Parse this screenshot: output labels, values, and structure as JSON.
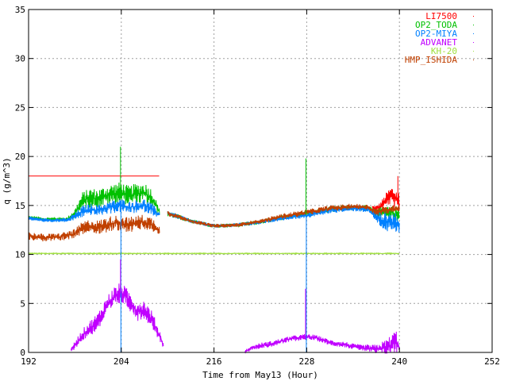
{
  "chart_data": {
    "type": "line",
    "title": "",
    "xlabel": "Time from May13 (Hour)",
    "ylabel": "q (g/m^3)",
    "xlim": [
      192,
      252
    ],
    "ylim": [
      0,
      35
    ],
    "x_ticks": [
      192,
      204,
      216,
      228,
      240,
      252
    ],
    "y_ticks": [
      0,
      5,
      10,
      15,
      20,
      25,
      30,
      35
    ],
    "x_tick_labels": [
      "192",
      "204",
      "216",
      "228",
      "240",
      "252"
    ],
    "y_tick_labels": [
      "0",
      "5",
      "10",
      "15",
      "20",
      "25",
      "30",
      "35"
    ],
    "grid": true,
    "legend_position": "top-right",
    "series": [
      {
        "name": "LI7500",
        "color": "#ff0000",
        "x": [
          192,
          209,
          209.01,
          236.5,
          237,
          237.5,
          238,
          238.5,
          239,
          239.5,
          240
        ],
        "y": [
          18,
          18,
          null,
          14.8,
          14.7,
          14.9,
          15.3,
          15.8,
          16.0,
          15.6,
          15.2
        ],
        "noise": [
          0,
          0,
          0,
          0.2,
          0.3,
          0.4,
          0.6,
          0.8,
          1.0,
          1.2,
          1.2
        ]
      },
      {
        "name": "OP2_TODA",
        "color": "#00c000",
        "x": [
          192,
          194,
          197,
          198,
          199,
          200,
          201,
          202,
          203,
          204,
          205,
          206,
          207,
          208,
          209,
          209.01,
          210,
          213,
          216,
          219,
          222,
          225,
          228,
          231,
          234,
          236,
          237,
          238,
          239,
          240
        ],
        "y": [
          13.8,
          13.6,
          13.6,
          14.2,
          15.5,
          15.8,
          15.7,
          16.0,
          16.2,
          16.3,
          16.0,
          16.2,
          16.3,
          15.7,
          14.2,
          null,
          14.2,
          13.4,
          12.9,
          13.0,
          13.3,
          13.8,
          14.2,
          14.6,
          14.8,
          14.7,
          14.2,
          14.4,
          14.3,
          14.0
        ],
        "noise": [
          0.2,
          0.2,
          0.2,
          0.5,
          0.9,
          1.0,
          1.0,
          1.0,
          1.1,
          1.1,
          1.0,
          1.1,
          1.1,
          1.0,
          0.3,
          0,
          0.3,
          0.2,
          0.2,
          0.2,
          0.2,
          0.3,
          0.3,
          0.3,
          0.3,
          0.3,
          0.4,
          0.6,
          0.8,
          0.8
        ]
      },
      {
        "name": "OP2-MIYA",
        "color": "#0080ff",
        "x": [
          192,
          194,
          197,
          198,
          199,
          200,
          201,
          202,
          203,
          204,
          205,
          206,
          207,
          208,
          209,
          209.01,
          210,
          213,
          216,
          219,
          222,
          225,
          228,
          231,
          234,
          236,
          237,
          238,
          239,
          240
        ],
        "y": [
          13.7,
          13.5,
          13.5,
          13.9,
          14.4,
          14.6,
          14.5,
          14.7,
          14.9,
          15.0,
          14.8,
          14.9,
          15.0,
          14.6,
          14.0,
          null,
          14.2,
          13.4,
          12.9,
          13.0,
          13.3,
          13.7,
          14.0,
          14.5,
          14.7,
          14.6,
          13.8,
          13.4,
          13.2,
          13.2
        ],
        "noise": [
          0.2,
          0.2,
          0.2,
          0.4,
          0.6,
          0.6,
          0.6,
          0.6,
          0.7,
          0.7,
          0.6,
          0.7,
          0.7,
          0.6,
          0.3,
          0,
          0.3,
          0.2,
          0.2,
          0.2,
          0.2,
          0.2,
          0.3,
          0.3,
          0.3,
          0.3,
          0.6,
          1.0,
          1.2,
          1.2
        ]
      },
      {
        "name": "ADVANET",
        "color": "#c000ff",
        "x": [
          192,
          197,
          197.5,
          198,
          199,
          200,
          201,
          202,
          203,
          204,
          205,
          206,
          207,
          208,
          209,
          209.5,
          209.51,
          219.99,
          220,
          221,
          222,
          223,
          224,
          225,
          226,
          227,
          228,
          229,
          230,
          231,
          232,
          233,
          234,
          235,
          236,
          237,
          238,
          239,
          239.5,
          240
        ],
        "y": [
          null,
          null,
          0.2,
          0.8,
          1.8,
          2.5,
          3.2,
          4.6,
          5.6,
          6.1,
          5.3,
          4.2,
          4.4,
          3.3,
          1.6,
          0.6,
          null,
          null,
          0.1,
          0.5,
          0.7,
          0.8,
          1.0,
          1.2,
          1.4,
          1.5,
          1.6,
          1.5,
          1.3,
          1.0,
          0.9,
          0.8,
          0.6,
          0.5,
          0.4,
          0.3,
          0.5,
          0.8,
          1.2,
          0.6
        ],
        "noise": [
          0,
          0,
          0.2,
          0.4,
          0.6,
          0.8,
          0.9,
          1.0,
          1.1,
          1.1,
          1.0,
          1.0,
          1.0,
          0.9,
          0.6,
          0.3,
          0,
          0,
          0.1,
          0.2,
          0.3,
          0.3,
          0.3,
          0.3,
          0.3,
          0.3,
          0.3,
          0.3,
          0.3,
          0.3,
          0.3,
          0.3,
          0.3,
          0.3,
          0.4,
          0.5,
          0.7,
          1.0,
          1.3,
          0.6
        ]
      },
      {
        "name": "KH-20",
        "color": "#a0e040",
        "x": [
          192,
          240
        ],
        "y": [
          10.1,
          10.1
        ],
        "noise": [
          0.05,
          0.05
        ]
      },
      {
        "name": "HMP_ISHIDA",
        "color": "#c04000",
        "x": [
          192,
          194,
          196,
          198,
          199,
          200,
          201,
          202,
          203,
          204,
          205,
          206,
          207,
          208,
          209,
          209.01,
          210,
          213,
          216,
          219,
          222,
          225,
          228,
          231,
          234,
          236,
          237,
          238,
          239,
          240
        ],
        "y": [
          11.9,
          11.7,
          11.8,
          12.1,
          12.7,
          12.9,
          12.8,
          13.0,
          13.2,
          13.2,
          13.0,
          13.2,
          13.3,
          13.0,
          12.5,
          null,
          14.2,
          13.4,
          12.9,
          13.0,
          13.4,
          13.9,
          14.3,
          14.7,
          14.9,
          14.8,
          14.3,
          14.5,
          14.6,
          14.8
        ],
        "noise": [
          0.4,
          0.4,
          0.4,
          0.5,
          0.7,
          0.7,
          0.7,
          0.8,
          0.8,
          0.8,
          0.8,
          0.8,
          0.8,
          0.8,
          0.5,
          0,
          0.3,
          0.2,
          0.2,
          0.2,
          0.2,
          0.3,
          0.3,
          0.3,
          0.3,
          0.3,
          0.4,
          0.4,
          0.4,
          0.4
        ]
      }
    ],
    "spikes": [
      {
        "series": "OP2_TODA",
        "x": 203.9,
        "y": 21.0
      },
      {
        "series": "OP2-MIYA",
        "x": 203.95,
        "y": 0.0
      },
      {
        "series": "ADVANET",
        "x": 203.9,
        "y": 9.5
      },
      {
        "series": "OP2_TODA",
        "x": 227.9,
        "y": 19.8
      },
      {
        "series": "OP2-MIYA",
        "x": 227.95,
        "y": 0.0
      },
      {
        "series": "ADVANET",
        "x": 227.85,
        "y": 6.5
      },
      {
        "series": "LI7500",
        "x": 239.8,
        "y": 18.0
      }
    ]
  }
}
